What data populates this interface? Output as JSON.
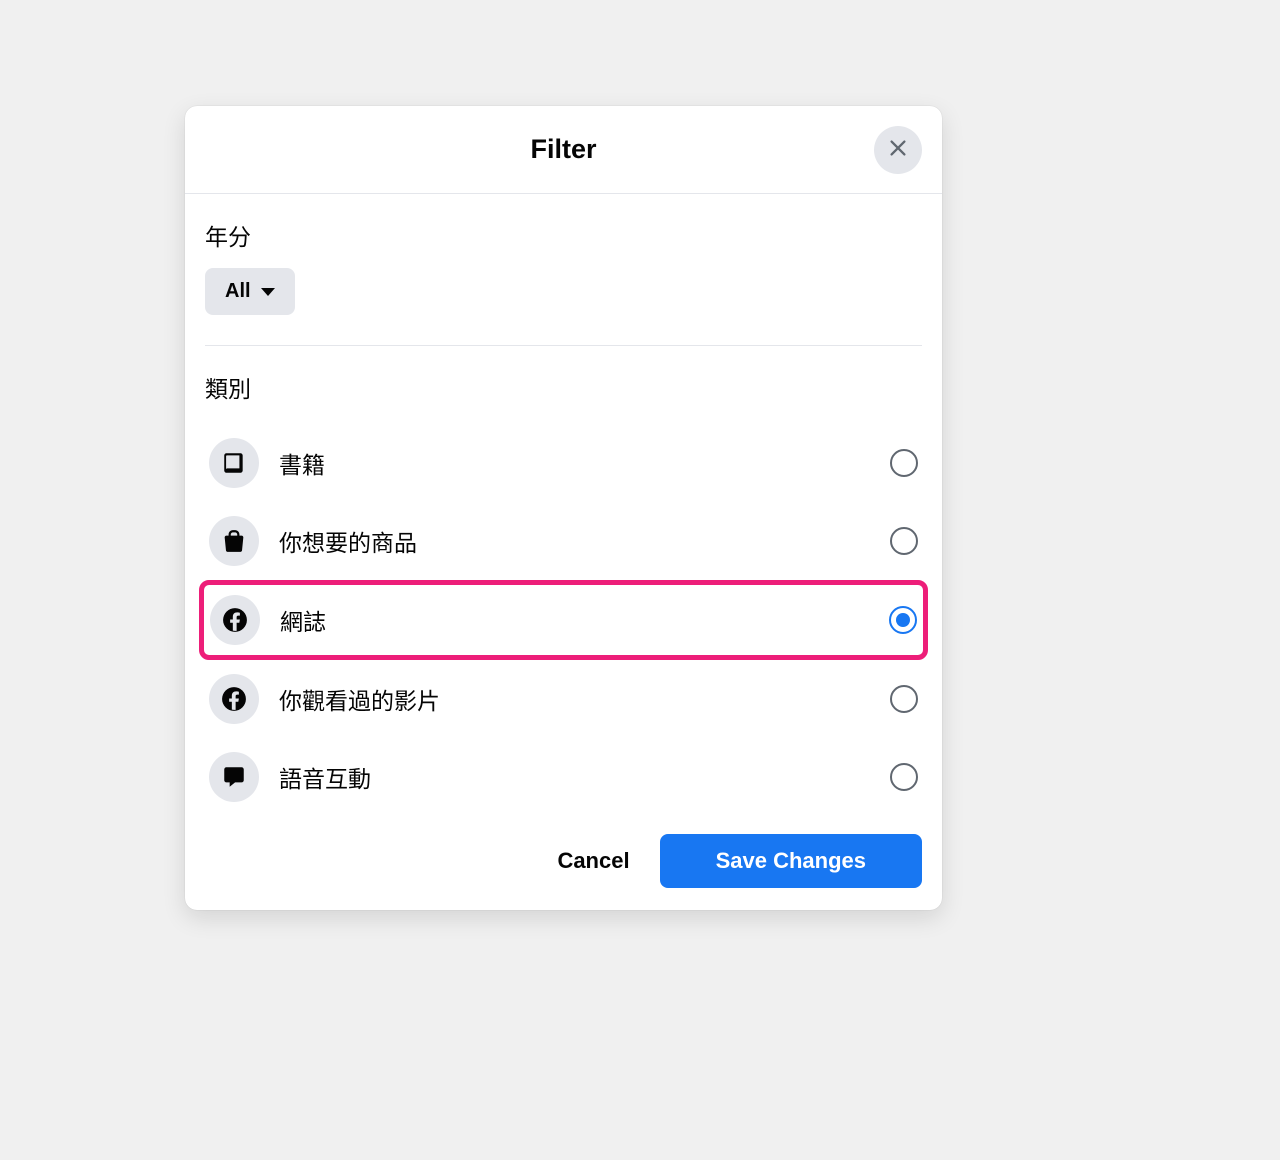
{
  "modal": {
    "title": "Filter",
    "year_section_label": "年分",
    "year_dropdown_value": "All",
    "category_section_label": "類別",
    "categories": [
      {
        "icon": "book-icon",
        "label": "書籍",
        "selected": false,
        "highlighted": false
      },
      {
        "icon": "shopping-bag-icon",
        "label": "你想要的商品",
        "selected": false,
        "highlighted": false
      },
      {
        "icon": "facebook-icon",
        "label": "網誌",
        "selected": true,
        "highlighted": true
      },
      {
        "icon": "facebook-icon",
        "label": "你觀看過的影片",
        "selected": false,
        "highlighted": false
      },
      {
        "icon": "speech-bubble-icon",
        "label": "語音互動",
        "selected": false,
        "highlighted": false
      }
    ],
    "cancel_label": "Cancel",
    "save_label": "Save Changes"
  }
}
